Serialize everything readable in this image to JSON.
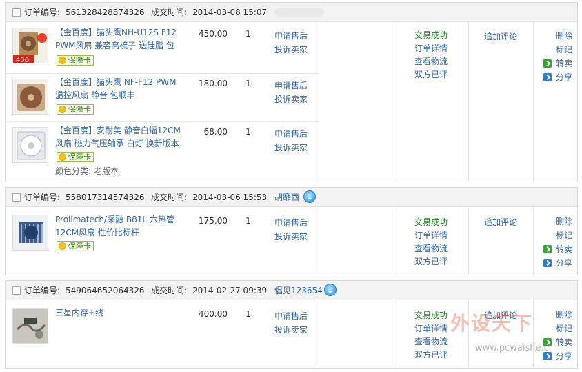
{
  "labels": {
    "order_no": "订单编号:",
    "deal_time": "成交时间:",
    "guarantee": "保障卡",
    "apply_after_sale": "申请售后",
    "complain_seller": "投诉卖家",
    "add_review": "追加评论",
    "delete": "删除",
    "mark": "标记",
    "resell": "转卖",
    "share": "分享"
  },
  "orders": [
    {
      "order_no": "561328428874326",
      "time": "2014-03-08 15:07",
      "seller": "",
      "status": [
        "交易成功",
        "订单详情",
        "查看物流",
        "双方已评"
      ],
      "items": [
        {
          "title": "【金百度】猫头鹰NH-U12S F12 PWM风扇 兼容高梳子 送硅脂 包",
          "price": "450.00",
          "qty": "1",
          "thumb_text": "450"
        },
        {
          "title": "【金百度】猫头鹰 NF-F12 PWM 温控风扇 静音 包顺丰",
          "price": "180.00",
          "qty": "1"
        },
        {
          "title": "【金百度】安耐美 静音白蝠12CM 风扇 磁力气压轴承 白灯 换新版本",
          "price": "68.00",
          "qty": "1",
          "attr": "颜色分类: 老版本"
        }
      ]
    },
    {
      "order_no": "558017314574326",
      "time": "2014-03-06 15:53",
      "seller": "胡靡西",
      "status": [
        "交易成功",
        "订单详情",
        "查看物流",
        "双方已评"
      ],
      "items": [
        {
          "title": "Prolimatech/采融 B81L 六热管 12CM风扇 性价比标杆",
          "price": "175.00",
          "qty": "1"
        }
      ]
    },
    {
      "order_no": "549064652064326",
      "time": "2014-02-27 09:39",
      "seller": "倡见123654",
      "status": [
        "交易成功",
        "订单详情",
        "查看物流",
        "双方已评"
      ],
      "items": [
        {
          "title": "三星内存+线",
          "price": "400.00",
          "qty": "1"
        }
      ]
    }
  ],
  "watermark": {
    "text": "外设天下",
    "url": "www.pcwaishe.c"
  }
}
